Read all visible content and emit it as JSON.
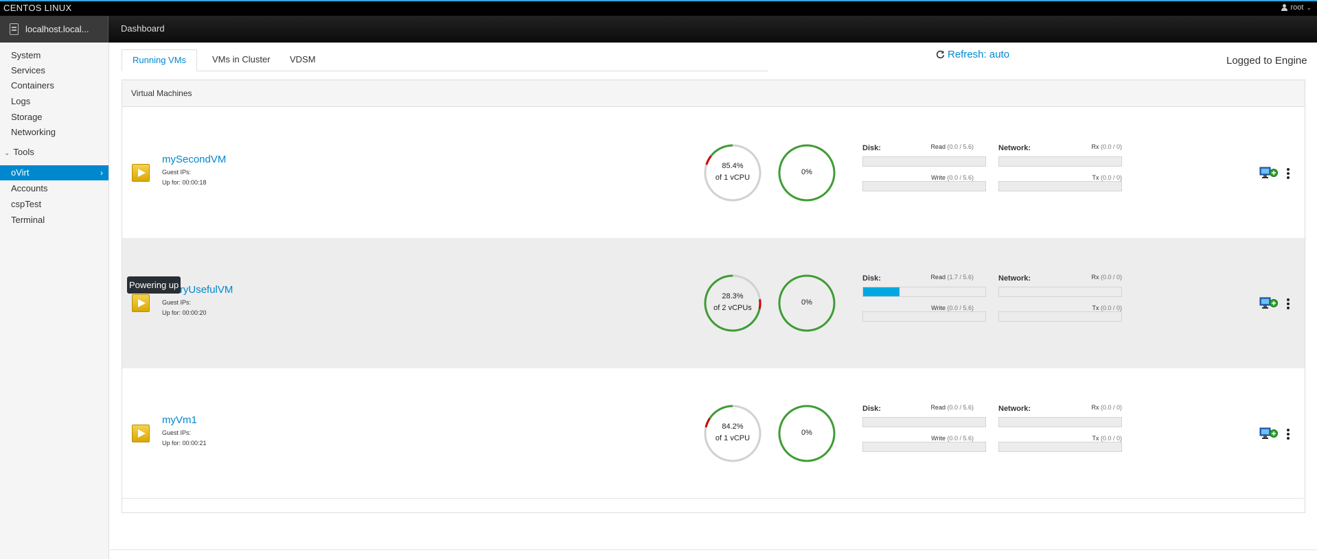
{
  "topbar": {
    "brand": "CENTOS LINUX",
    "user": "root"
  },
  "hostbar": {
    "host": "localhost.local...",
    "dashboard": "Dashboard"
  },
  "sidebar": {
    "items": [
      {
        "label": "System"
      },
      {
        "label": "Services"
      },
      {
        "label": "Containers"
      },
      {
        "label": "Logs"
      },
      {
        "label": "Storage"
      },
      {
        "label": "Networking"
      }
    ],
    "tools_label": "Tools",
    "tools_items": [
      {
        "label": "oVirt",
        "active": true
      },
      {
        "label": "Accounts"
      },
      {
        "label": "cspTest"
      },
      {
        "label": "Terminal"
      }
    ]
  },
  "main": {
    "tabs": [
      {
        "label": "Running VMs",
        "active": true
      },
      {
        "label": "VMs in Cluster"
      },
      {
        "label": "VDSM"
      }
    ],
    "refresh": "Refresh: auto",
    "logged": "Logged to Engine",
    "panel_title": "Virtual Machines"
  },
  "labels": {
    "guest_ips": "Guest IPs:",
    "disk": "Disk:",
    "network": "Network:",
    "read": "Read",
    "write": "Write",
    "rx": "Rx",
    "tx": "Tx"
  },
  "vms": [
    {
      "name": "mySecondVM",
      "uptime": "Up for: 00:00:18",
      "cpu_percent": "85.4%",
      "cpu_value": 85.4,
      "cpu_sub": "of 1 vCPU",
      "mem_percent": "0%",
      "disk_read": "(0.0 / 5.6)",
      "disk_read_value": 0.0,
      "disk_write": "(0.0 / 5.6)",
      "net_rx": "(0.0 / 0)",
      "net_tx": "(0.0 / 0)"
    },
    {
      "name": "aVeryUsefulVM",
      "uptime": "Up for: 00:00:20",
      "cpu_percent": "28.3%",
      "cpu_value": 28.3,
      "cpu_sub": "of 2 vCPUs",
      "mem_percent": "0%",
      "disk_read": "(1.7 / 5.6)",
      "disk_read_value": 0.3,
      "disk_write": "(0.0 / 5.6)",
      "net_rx": "(0.0 / 0)",
      "net_tx": "(0.0 / 0)"
    },
    {
      "name": "myVm1",
      "uptime": "Up for: 00:00:21",
      "cpu_percent": "84.2%",
      "cpu_value": 84.2,
      "cpu_sub": "of 1 vCPU",
      "mem_percent": "0%",
      "disk_read": "(0.0 / 5.6)",
      "disk_read_value": 0.0,
      "disk_write": "(0.0 / 5.6)",
      "net_rx": "(0.0 / 0)",
      "net_tx": "(0.0 / 0)"
    }
  ],
  "tooltip": "Powering up",
  "colors": {
    "accent": "#0088ce",
    "ok": "#3f9c35",
    "danger": "#cc0000",
    "track": "#d1d1d1"
  }
}
